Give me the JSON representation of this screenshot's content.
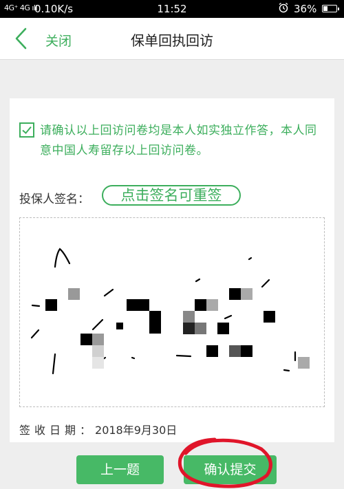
{
  "status_bar": {
    "signal": "4G⁺ 4G ıll",
    "net_speed": "0.10K/s",
    "time": "11:52",
    "battery_percent": "36%",
    "battery_level": 0.36,
    "icons": [
      "signal-icon",
      "alarm-icon",
      "battery-icon"
    ]
  },
  "nav": {
    "back_icon": "chevron-left-icon",
    "close_label": "关闭",
    "title": "保单回执回访"
  },
  "consent": {
    "checked": true,
    "text": "请确认以上回访问卷均是本人如实独立作答，本人同意中国人寿留存以上回访问卷。"
  },
  "signature": {
    "label": "投保人签名：",
    "resign_label": "点击签名可重签"
  },
  "sign_date": {
    "label": "签收日期：",
    "value": "2018年9月30日"
  },
  "buttons": {
    "prev_label": "上一题",
    "submit_label": "确认提交"
  },
  "colors": {
    "accent": "#3cae5c",
    "button_green": "#47b966",
    "annotation_red": "#e0152a"
  }
}
